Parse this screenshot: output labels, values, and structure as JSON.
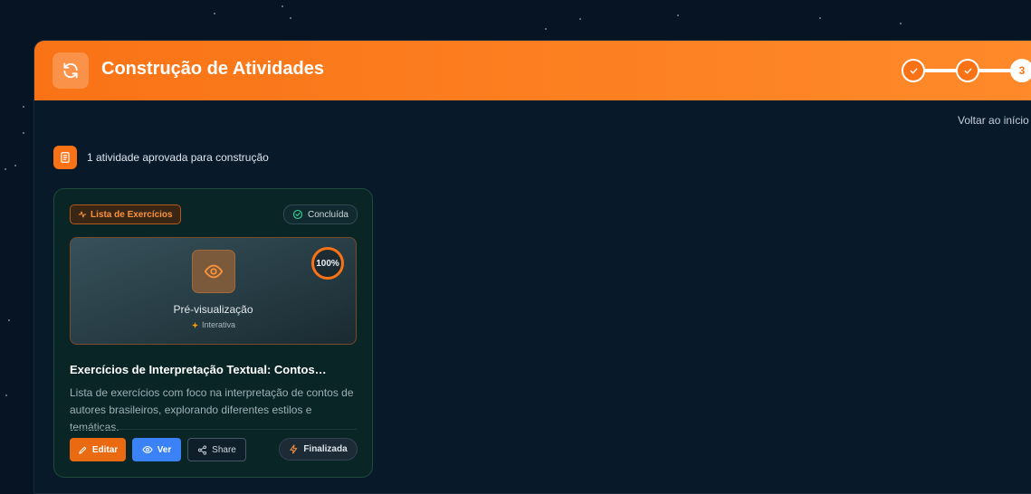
{
  "header": {
    "title": "Construção de Atividades",
    "steps": [
      {
        "state": "done"
      },
      {
        "state": "done"
      },
      {
        "state": "current",
        "label": "3"
      }
    ]
  },
  "back_link": "Voltar ao início",
  "approved_summary": "1 atividade aprovada para construção",
  "card": {
    "type_tag": "Lista de Exercícios",
    "status": "Concluída",
    "preview_label": "Pré-visualização",
    "preview_sub": "Interativa",
    "progress": "100%",
    "title": "Exercícios de Interpretação Textual: Contos…",
    "description": "Lista de exercícios com foco na interpretação de contos de autores brasileiros, explorando diferentes estilos e temáticas.",
    "buttons": {
      "edit": "Editar",
      "view": "Ver",
      "share": "Share",
      "final": "Finalizada"
    }
  },
  "colors": {
    "accent": "#f97316",
    "background": "#061423",
    "card_bg": "#0a2525",
    "view_button": "#3b82f6"
  }
}
